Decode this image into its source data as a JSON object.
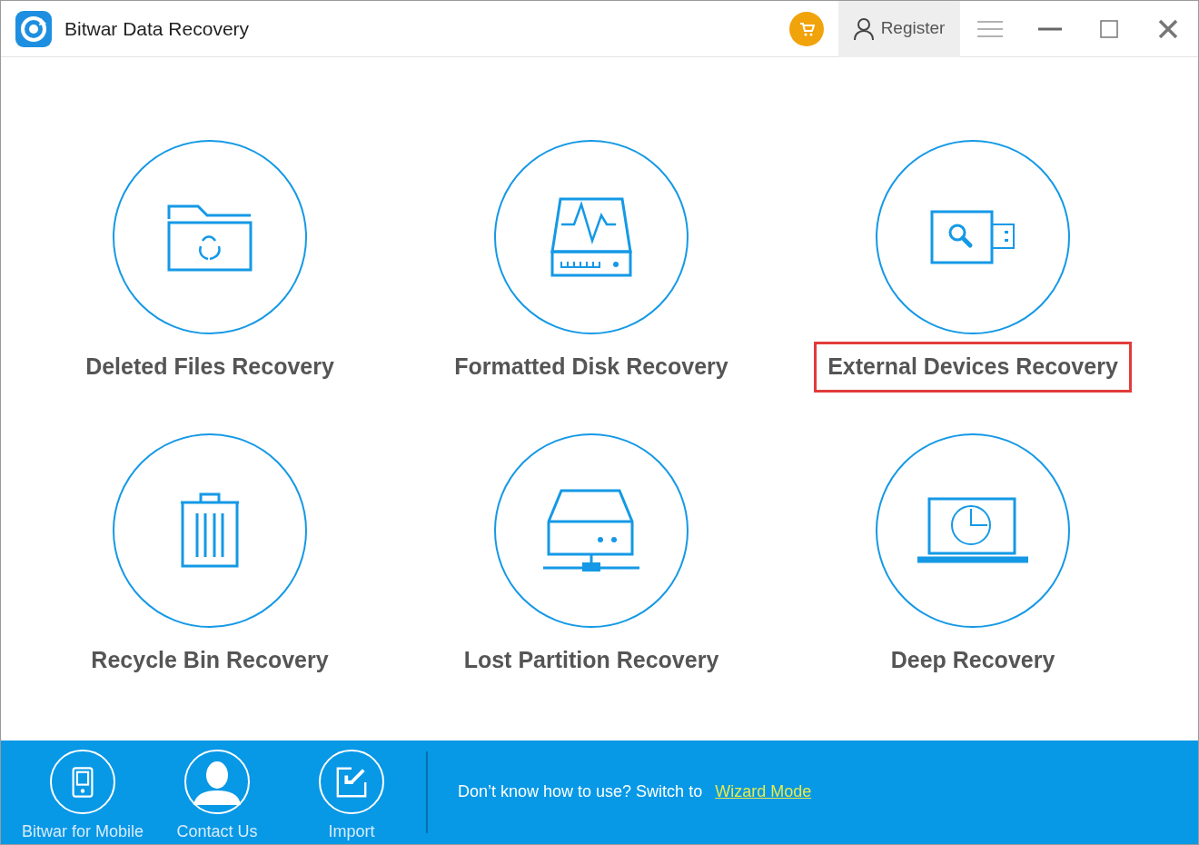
{
  "window": {
    "title": "Bitwar Data Recovery"
  },
  "titlebar": {
    "register_button": "Register"
  },
  "recovery_modes": [
    {
      "kind": "deleted",
      "label": "Deleted Files Recovery",
      "highlighted": false
    },
    {
      "kind": "formatted",
      "label": "Formatted Disk Recovery",
      "highlighted": false
    },
    {
      "kind": "external",
      "label": "External Devices Recovery",
      "highlighted": true
    },
    {
      "kind": "recycle",
      "label": "Recycle Bin Recovery",
      "highlighted": false
    },
    {
      "kind": "partition",
      "label": "Lost Partition Recovery",
      "highlighted": false
    },
    {
      "kind": "deep",
      "label": "Deep Recovery",
      "highlighted": false
    }
  ],
  "bottom_bar": {
    "shortcuts": [
      {
        "kind": "mobile",
        "label": "Bitwar for Mobile"
      },
      {
        "kind": "contact",
        "label": "Contact Us"
      },
      {
        "kind": "import",
        "label": "Import"
      }
    ],
    "hint": "Don’t know how to use? Switch to",
    "link": "Wizard Mode"
  }
}
